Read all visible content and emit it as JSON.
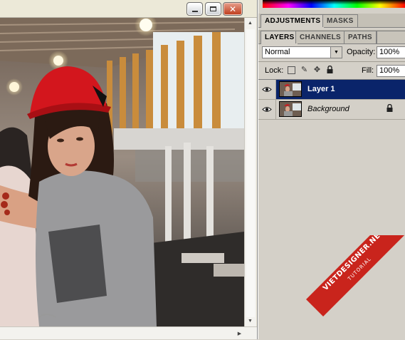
{
  "document_window": {
    "buttons": {
      "minimize": "minimize",
      "maximize": "maximize",
      "close": "close"
    }
  },
  "panels": {
    "top_tabs": [
      "ADJUSTMENTS",
      "MASKS"
    ],
    "layer_tabs": [
      "LAYERS",
      "CHANNELS",
      "PATHS"
    ],
    "blend_mode": "Normal",
    "opacity_label": "Opacity:",
    "opacity_value": "100%",
    "lock_label": "Lock:",
    "fill_label": "Fill:",
    "fill_value": "100%",
    "layers": [
      {
        "name": "Layer 1",
        "selected": true,
        "visible": true,
        "locked": false
      },
      {
        "name": "Background",
        "selected": false,
        "visible": true,
        "locked": true
      }
    ]
  },
  "watermark": {
    "brand": "VIETDESIGNER.NET",
    "sub": "TUTORIAL"
  },
  "colors": {
    "selection": "#0a246a",
    "panel_bg": "#d4d0c8",
    "accent_red": "#c9241c",
    "hat_red": "#d3161d"
  }
}
